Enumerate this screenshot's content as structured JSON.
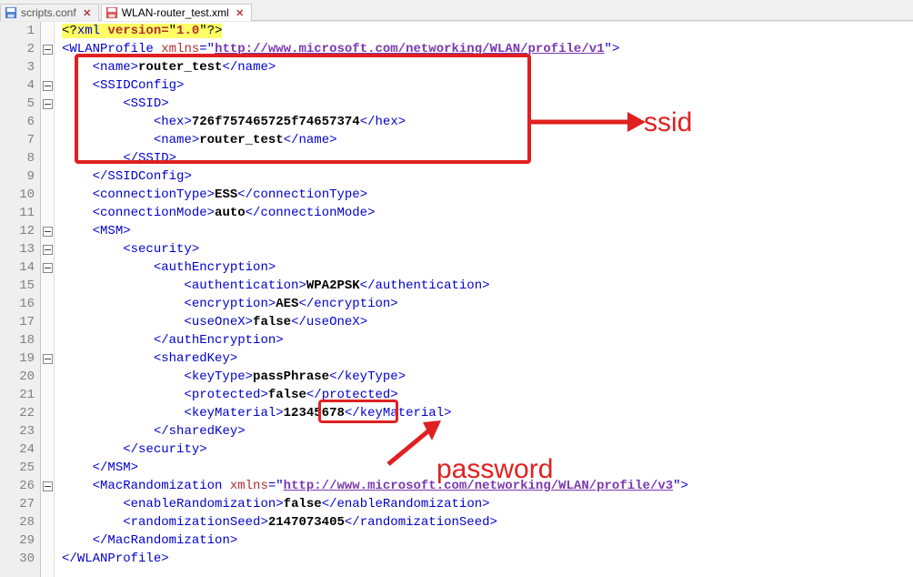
{
  "tabs": [
    {
      "label": "scripts.conf",
      "active": false,
      "icon": "disk-blue"
    },
    {
      "label": "WLAN-router_test.xml",
      "active": true,
      "icon": "disk-red"
    }
  ],
  "line_numbers": {
    "from": 1,
    "to": 30
  },
  "code": {
    "l1": {
      "pi_open": "<?",
      "pi_name": "xml ",
      "pi_attr": "version=",
      "pi_q": "\"",
      "pi_val": "1.0",
      "pi_close": "?>"
    },
    "l2": {
      "open": "<",
      "tag": "WLANProfile",
      "sp": " ",
      "attr": "xmlns",
      "eq": "=\"",
      "url": "http://www.microsoft.com/networking/WLAN/profile/v1",
      "close": "\">"
    },
    "l3": {
      "open": "<",
      "tag": "name",
      "gt": ">",
      "text": "router_test",
      "co": "</",
      "ct": ">"
    },
    "l4": {
      "open": "<",
      "tag": "SSIDConfig",
      "gt": ">"
    },
    "l5": {
      "open": "<",
      "tag": "SSID",
      "gt": ">"
    },
    "l6": {
      "open": "<",
      "tag": "hex",
      "gt": ">",
      "text": "726f757465725f74657374",
      "co": "</",
      "ct": ">"
    },
    "l7": {
      "open": "<",
      "tag": "name",
      "gt": ">",
      "text": "router_test",
      "co": "</",
      "ct": ">"
    },
    "l8": {
      "open": "</",
      "tag": "SSID",
      "gt": ">"
    },
    "l9": {
      "open": "</",
      "tag": "SSIDConfig",
      "gt": ">"
    },
    "l10": {
      "open": "<",
      "tag": "connectionType",
      "gt": ">",
      "text": "ESS",
      "co": "</",
      "ct": ">"
    },
    "l11": {
      "open": "<",
      "tag": "connectionMode",
      "gt": ">",
      "text": "auto",
      "co": "</",
      "ct": ">"
    },
    "l12": {
      "open": "<",
      "tag": "MSM",
      "gt": ">"
    },
    "l13": {
      "open": "<",
      "tag": "security",
      "gt": ">"
    },
    "l14": {
      "open": "<",
      "tag": "authEncryption",
      "gt": ">"
    },
    "l15": {
      "open": "<",
      "tag": "authentication",
      "gt": ">",
      "text": "WPA2PSK",
      "co": "</",
      "ct": ">"
    },
    "l16": {
      "open": "<",
      "tag": "encryption",
      "gt": ">",
      "text": "AES",
      "co": "</",
      "ct": ">"
    },
    "l17": {
      "open": "<",
      "tag": "useOneX",
      "gt": ">",
      "text": "false",
      "co": "</",
      "ct": ">"
    },
    "l18": {
      "open": "</",
      "tag": "authEncryption",
      "gt": ">"
    },
    "l19": {
      "open": "<",
      "tag": "sharedKey",
      "gt": ">"
    },
    "l20": {
      "open": "<",
      "tag": "keyType",
      "gt": ">",
      "text": "passPhrase",
      "co": "</",
      "ct": ">"
    },
    "l21": {
      "open": "<",
      "tag": "protected",
      "gt": ">",
      "text": "false",
      "co": "</",
      "ct": ">"
    },
    "l22": {
      "open": "<",
      "tag": "keyMaterial",
      "gt": ">",
      "text": "12345678",
      "co": "</",
      "ct": ">"
    },
    "l23": {
      "open": "</",
      "tag": "sharedKey",
      "gt": ">"
    },
    "l24": {
      "open": "</",
      "tag": "security",
      "gt": ">"
    },
    "l25": {
      "open": "</",
      "tag": "MSM",
      "gt": ">"
    },
    "l26": {
      "open": "<",
      "tag": "MacRandomization",
      "sp": " ",
      "attr": "xmlns",
      "eq": "=\"",
      "url": "http://www.microsoft.com/networking/WLAN/profile/v3",
      "close": "\">"
    },
    "l27": {
      "open": "<",
      "tag": "enableRandomization",
      "gt": ">",
      "text": "false",
      "co": "</",
      "ct": ">"
    },
    "l28": {
      "open": "<",
      "tag": "randomizationSeed",
      "gt": ">",
      "text": "2147073405",
      "co": "</",
      "ct": ">"
    },
    "l29": {
      "open": "</",
      "tag": "MacRandomization",
      "gt": ">"
    },
    "l30": {
      "open": "</",
      "tag": "WLANProfile",
      "gt": ">"
    }
  },
  "annotations": {
    "ssid_label": "ssid",
    "password_label": "password"
  }
}
